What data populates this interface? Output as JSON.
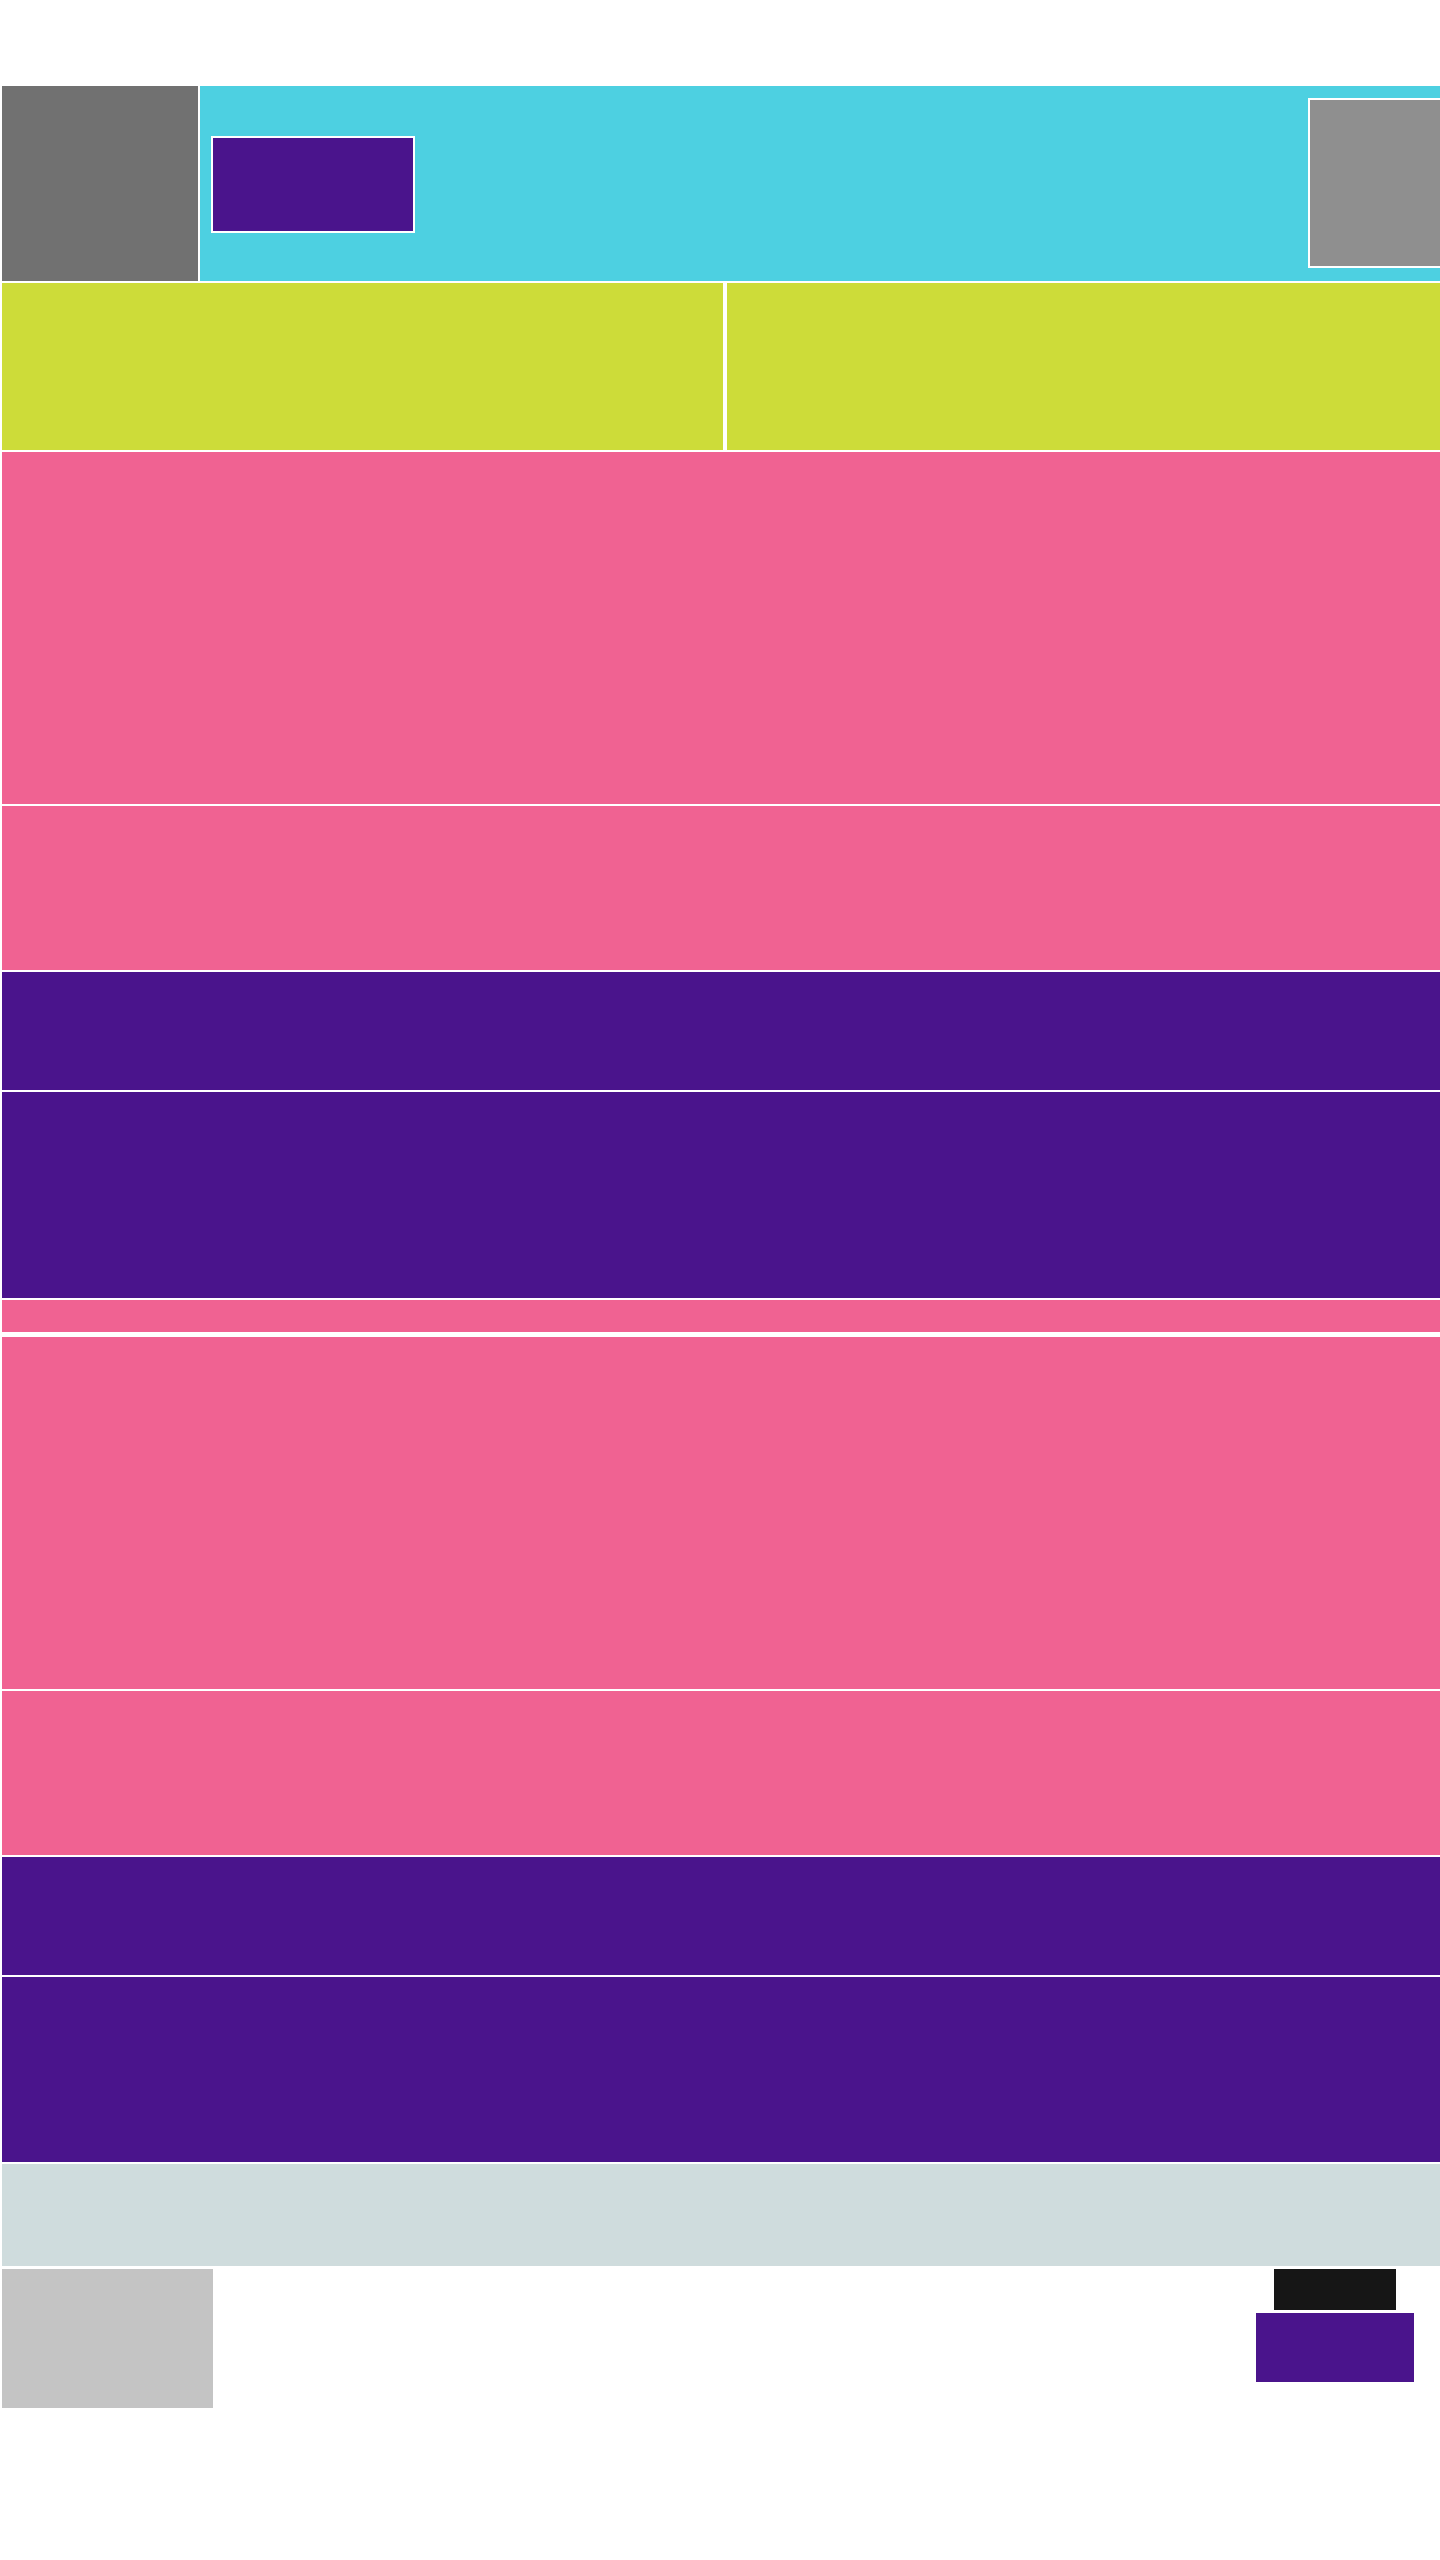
{
  "colors": {
    "page_bg": "#ffffff",
    "nav_icon_bg": "#717171",
    "toolbar_bg": "#4dd0e1",
    "toolbar_button_bg": "#4a148c",
    "toolbar_avatar_bg": "#8f8f8f",
    "tab_bg": "#cddc39",
    "card_pink": "#f06292",
    "card_purple": "#4a148c",
    "footer_bar_bg": "#cfdcdd",
    "thumbnail_bg": "#c4c4c4",
    "badge_bg": "#161616",
    "fab_bg": "#4a148c"
  },
  "toolbar": {
    "menu_button": "",
    "action_button": "",
    "avatar": ""
  },
  "tabs": [
    {
      "label": ""
    },
    {
      "label": ""
    }
  ],
  "feed": {
    "group_1": {
      "hero_card": "",
      "subtitle_card": "",
      "header_bar": "",
      "detail_card": ""
    },
    "separator_strip": "",
    "group_2": {
      "hero_card": "",
      "subtitle_card": "",
      "header_bar": "",
      "detail_card": ""
    }
  },
  "footer": {
    "bar": "",
    "thumbnail": "",
    "badge": "",
    "action_button": ""
  }
}
